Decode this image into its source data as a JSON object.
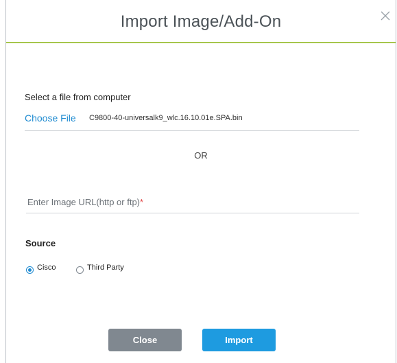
{
  "dialog": {
    "title": "Import Image/Add-On",
    "close_icon": "close-icon"
  },
  "file_section": {
    "label": "Select a file from computer",
    "choose_file_label": "Choose File",
    "selected_file": "C9800-40-universalk9_wlc.16.10.01e.SPA.bin"
  },
  "separator_text": "OR",
  "url_field": {
    "placeholder": "Enter Image URL(http or ftp)",
    "required_marker": "*",
    "value": ""
  },
  "source": {
    "label": "Source",
    "options": [
      {
        "label": "Cisco",
        "selected": true
      },
      {
        "label": "Third Party",
        "selected": false
      }
    ]
  },
  "buttons": {
    "close_label": "Close",
    "import_label": "Import"
  },
  "colors": {
    "accent_green": "#a6c64c",
    "link_blue": "#1f8bd1",
    "import_blue": "#1e9be0",
    "close_gray": "#808890",
    "required_red": "#e34a4a"
  }
}
